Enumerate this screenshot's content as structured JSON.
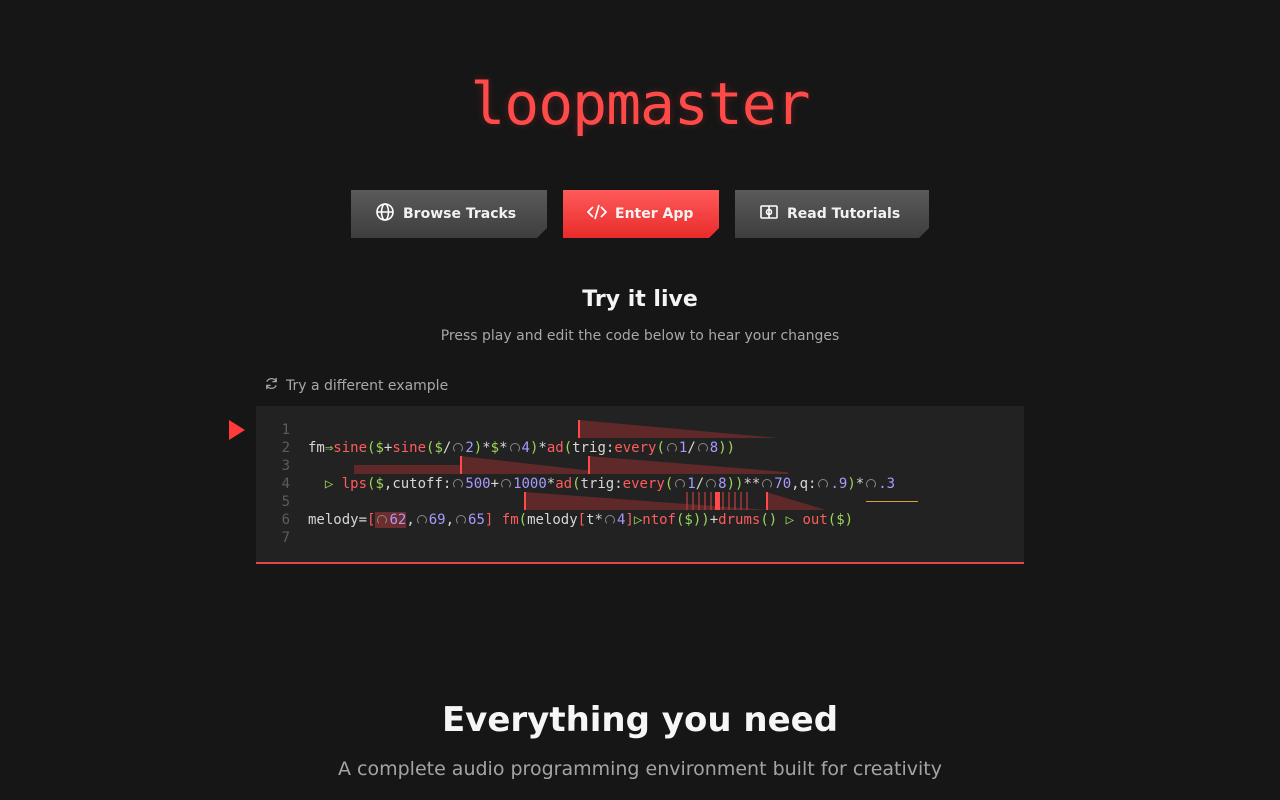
{
  "logo": "loopmaster",
  "buttons": {
    "browse": {
      "label": "Browse Tracks",
      "icon": "globe-icon"
    },
    "enter": {
      "label": "Enter App",
      "icon": "code-icon"
    },
    "tutorials": {
      "label": "Read Tutorials",
      "icon": "book-icon"
    }
  },
  "try_section": {
    "title": "Try it live",
    "subtitle": "Press play and edit the code below to hear your changes",
    "different_example": "Try a different example"
  },
  "editor": {
    "line_numbers": [
      "1",
      "2",
      "3",
      "4",
      "5",
      "6",
      "7"
    ]
  },
  "features": {
    "title": "Everything you need",
    "subtitle": "A complete audio programming environment built for creativity"
  },
  "colors": {
    "accent": "#ff4a4a",
    "background": "#161616",
    "editor_bg": "#222222"
  }
}
